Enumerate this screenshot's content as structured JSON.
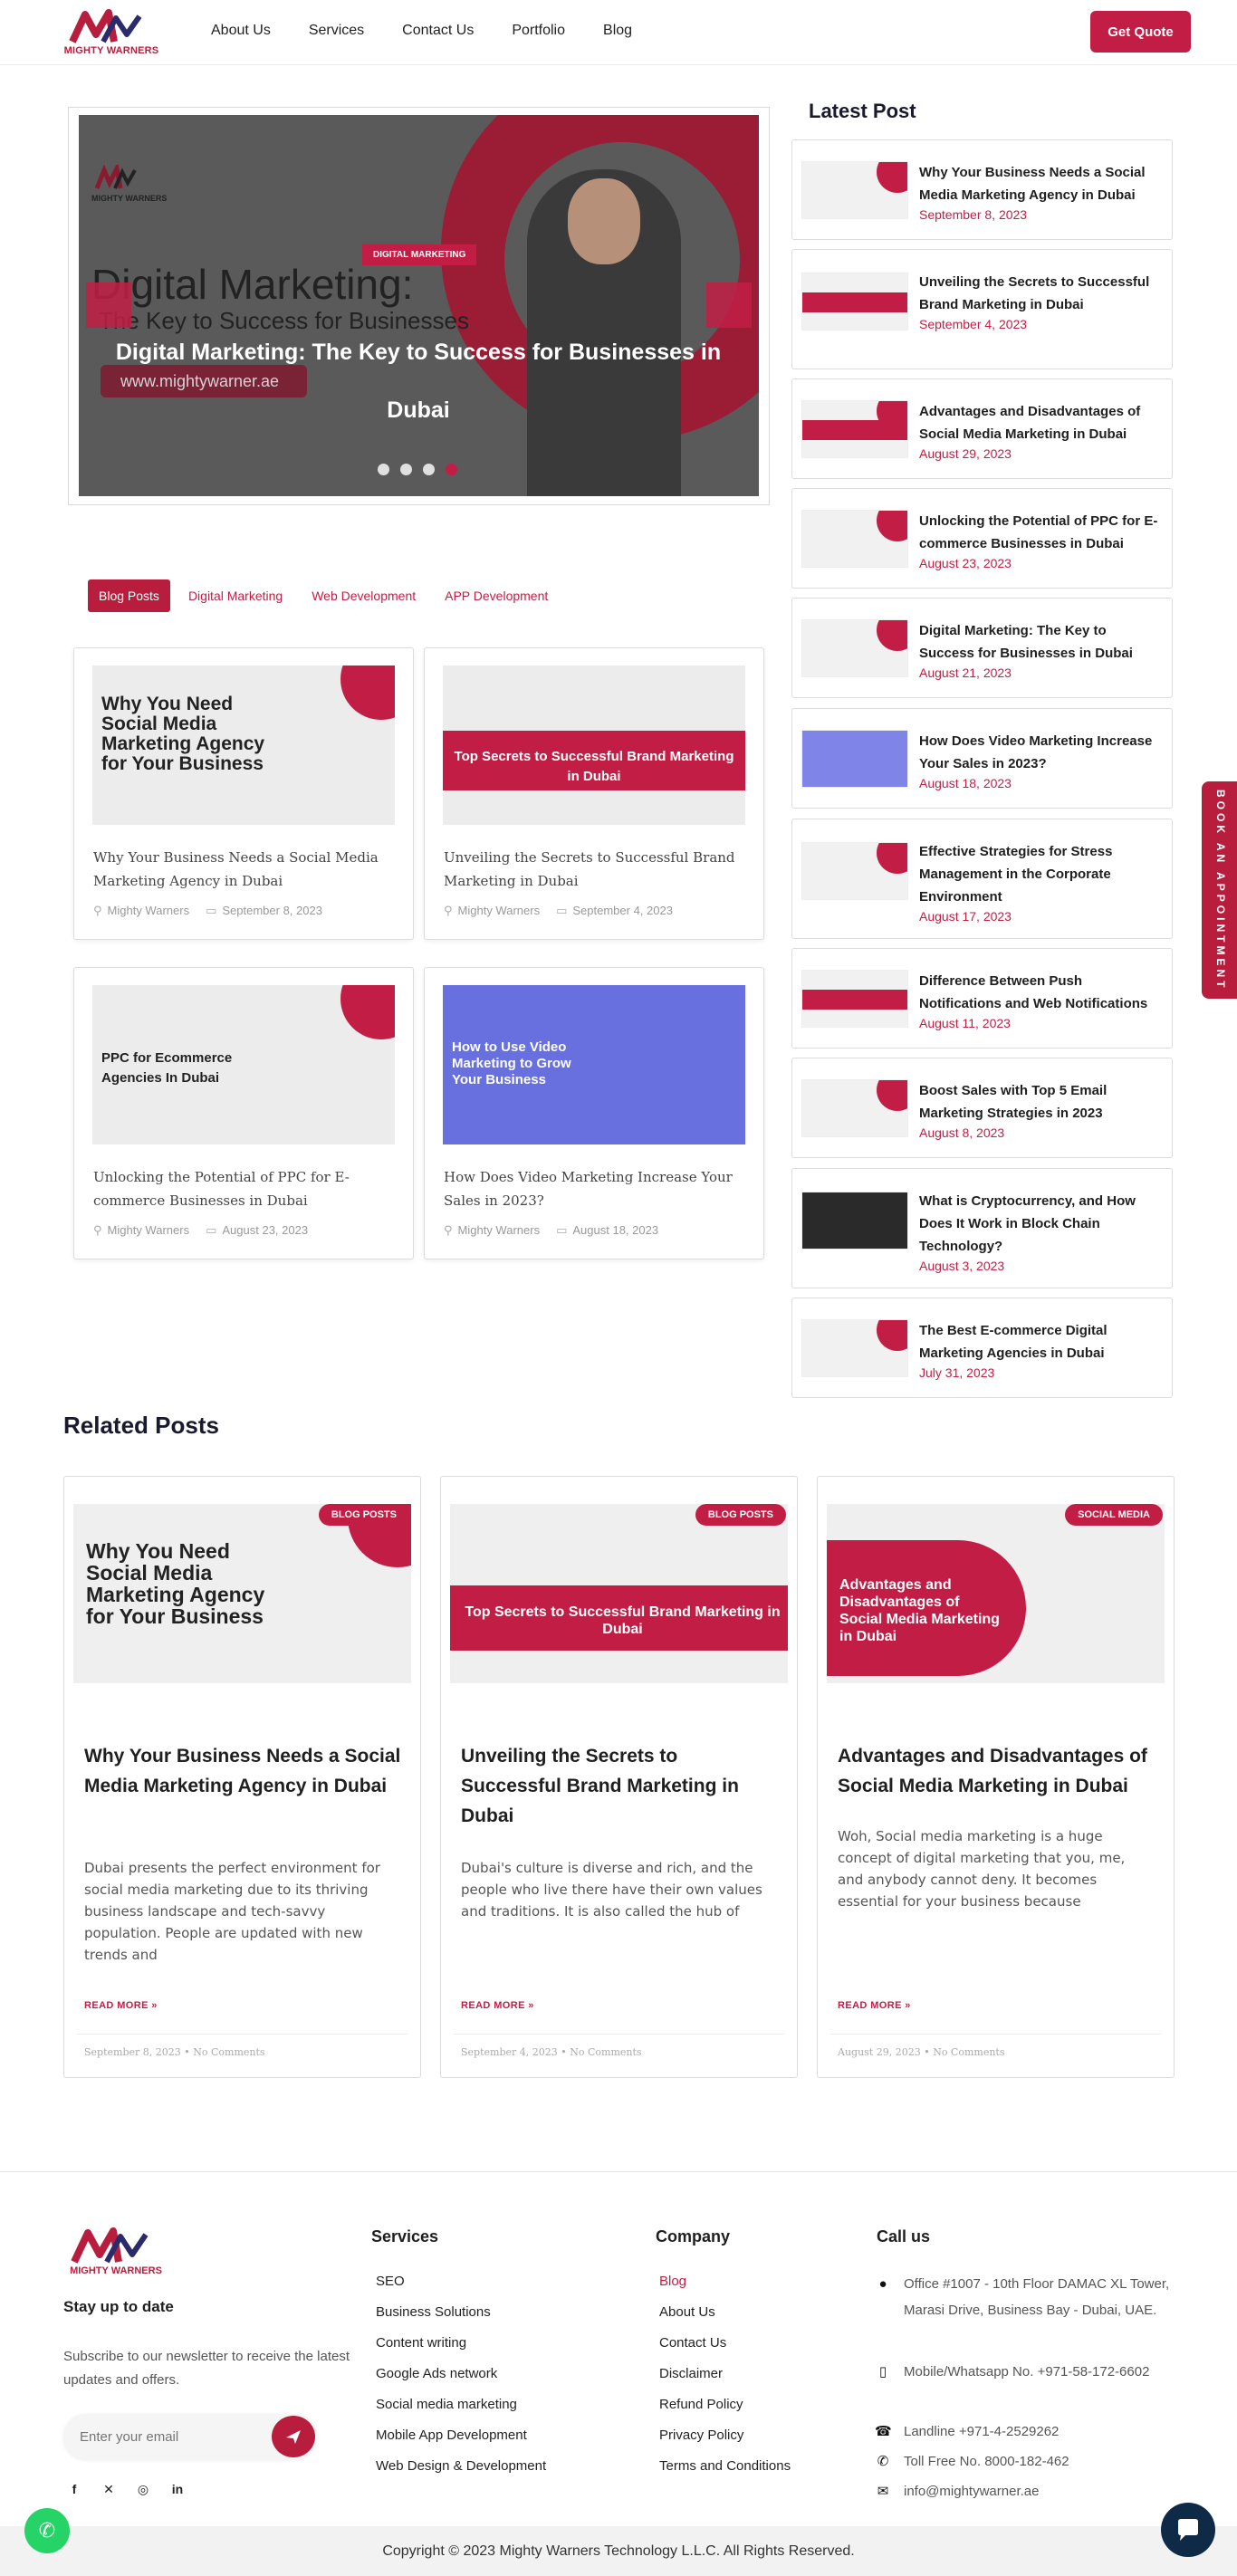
{
  "brand": {
    "logo_text": "MIGHTY WARNERS",
    "accent": "#c21e45",
    "dark_accent": "#b81d3d"
  },
  "nav": {
    "items": [
      "About Us",
      "Services",
      "Contact Us",
      "Portfolio",
      "Blog"
    ],
    "cta": "Get Quote"
  },
  "slider": {
    "logo_text": "MIGHTY WARNERS",
    "big_text": "Digital Marketing:",
    "sub_text": "The Key to Success for Businesses",
    "url_text": "www.mightywarner.ae",
    "badge": "DIGITAL MARKETING",
    "title": "Digital Marketing: The Key to Success for Businesses in Dubai",
    "dot_count": 4,
    "active_dot": 3
  },
  "latest": {
    "heading": "Latest Post",
    "posts": [
      {
        "title": "Why Your Business Needs a Social Media Marketing Agency in Dubai",
        "date": "September 8, 2023"
      },
      {
        "title": "Unveiling the Secrets to Successful Brand Marketing in Dubai",
        "date": "September 4, 2023"
      },
      {
        "title": "Advantages and Disadvantages of Social Media Marketing in Dubai",
        "date": "August 29, 2023"
      },
      {
        "title": "Unlocking the Potential of PPC for E-commerce Businesses in Dubai",
        "date": "August 23, 2023"
      },
      {
        "title": "Digital Marketing: The Key to Success for Businesses in Dubai",
        "date": "August 21, 2023"
      },
      {
        "title": "How Does Video Marketing Increase Your Sales in 2023?",
        "date": "August 18, 2023"
      },
      {
        "title": "Effective Strategies for Stress Management in the Corporate Environment",
        "date": "August 17, 2023"
      },
      {
        "title": "Difference Between Push Notifications and Web Notifications",
        "date": "August 11, 2023"
      },
      {
        "title": "Boost Sales with Top 5 Email Marketing Strategies in 2023",
        "date": "August 8, 2023"
      },
      {
        "title": "What is Cryptocurrency, and How Does It Work in Block Chain Technology?",
        "date": "August 3, 2023"
      },
      {
        "title": "The Best E-commerce Digital Marketing Agencies in Dubai",
        "date": "July 31, 2023"
      }
    ]
  },
  "tabs": [
    "Blog Posts",
    "Digital Marketing",
    "Web Development",
    "APP Development"
  ],
  "blog_cards": [
    {
      "img_text": "Why You Need Social Media Marketing Agency for Your Business",
      "title": "Why Your Business Needs a Social Media Marketing Agency in Dubai",
      "author": "Mighty Warners",
      "date": "September 8, 2023"
    },
    {
      "img_text": "Top Secrets to Successful Brand Marketing in Dubai",
      "title": "Unveiling the Secrets to Successful Brand Marketing in Dubai",
      "author": "Mighty Warners",
      "date": "September 4, 2023"
    },
    {
      "img_text": "PPC for Ecommerce Agencies In Dubai",
      "title": "Unlocking the Potential of PPC for E-commerce Businesses in Dubai",
      "author": "Mighty Warners",
      "date": "August 23, 2023"
    },
    {
      "img_text": "How to Use Video Marketing to Grow Your Business",
      "title": "How Does Video Marketing Increase Your Sales in 2023?",
      "author": "Mighty Warners",
      "date": "August 18, 2023"
    }
  ],
  "related": {
    "heading": "Related Posts",
    "posts": [
      {
        "badge": "BLOG POSTS",
        "img_text": "Why You Need Social Media Marketing Agency for Your Business",
        "title": "Why Your Business Needs a Social Media Marketing Agency in Dubai",
        "excerpt": "Dubai presents the perfect environment for social media marketing due to its thriving business landscape and tech-savvy population. People are updated with new trends and",
        "readmore": "READ MORE »",
        "date": "September 8, 2023",
        "comments": "No Comments"
      },
      {
        "badge": "BLOG POSTS",
        "img_text": "Top Secrets to Successful Brand Marketing in Dubai",
        "title": "Unveiling the Secrets to Successful Brand Marketing in Dubai",
        "excerpt": "Dubai's culture is diverse and rich, and the people who live there have their own values and traditions. It is also called the hub of",
        "readmore": "READ MORE »",
        "date": "September 4, 2023",
        "comments": "No Comments"
      },
      {
        "badge": "SOCIAL MEDIA",
        "img_text": "Advantages and Disadvantages of Social Media Marketing in Dubai",
        "title": "Advantages and Disadvantages of Social Media Marketing in Dubai",
        "excerpt": "Woh, Social media marketing is a huge concept of digital marketing that you, me, and anybody cannot deny. It becomes essential for your business because",
        "readmore": "READ MORE »",
        "date": "August 29, 2023",
        "comments": "No Comments"
      }
    ]
  },
  "footer": {
    "logo_text": "MIGHTY WARNERS",
    "stay_title": "Stay up to date",
    "subscribe_text": "Subscribe to our newsletter to receive the latest updates and offers.",
    "email_placeholder": "Enter your email",
    "services_title": "Services",
    "services": [
      "SEO",
      "Business Solutions",
      "Content writing",
      "Google Ads network",
      "Social media marketing",
      "Mobile App Development",
      "Web Design & Development"
    ],
    "company_title": "Company",
    "company": [
      "Blog",
      "About Us",
      "Contact Us",
      "Disclaimer",
      "Refund Policy",
      "Privacy Policy",
      "Terms and Conditions"
    ],
    "call_title": "Call us",
    "contacts": [
      {
        "icon": "map-pin-icon",
        "text": "Office #1007 - 10th Floor DAMAC XL Tower, Marasi Drive, Business Bay - Dubai, UAE."
      },
      {
        "icon": "mobile-icon",
        "text": "Mobile/Whatsapp No. +971-58-172-6602"
      },
      {
        "icon": "landline-icon",
        "text": "Landline +971-4-2529262"
      },
      {
        "icon": "phone-volume-icon",
        "text": "Toll Free No. 8000-182-462"
      },
      {
        "icon": "envelope-icon",
        "text": "info@mightywarner.ae"
      }
    ],
    "copyright": "Copyright © 2023 Mighty Warners Technology L.L.C. All Rights Reserved."
  },
  "widgets": {
    "book_tab": "BOOK AN APPOINTMENT"
  }
}
